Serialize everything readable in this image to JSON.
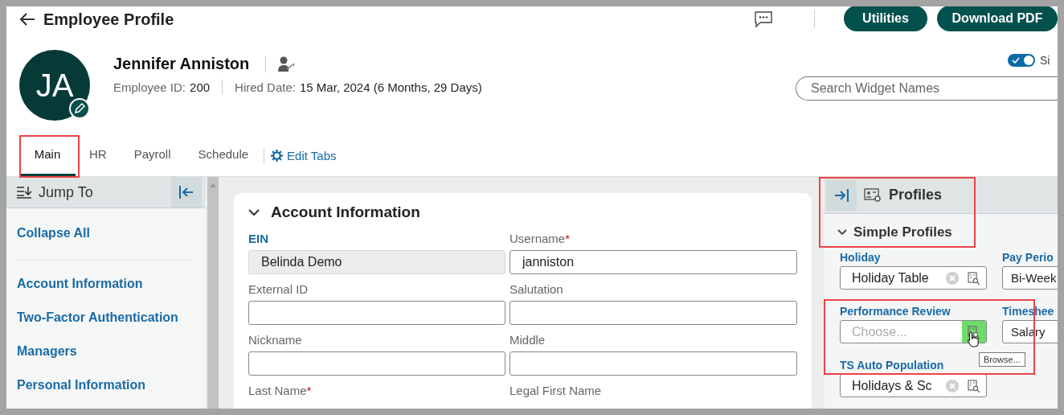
{
  "header": {
    "title": "Employee Profile",
    "buttons": [
      "Utilities",
      "Download PDF"
    ]
  },
  "employee": {
    "initials": "JA",
    "name": "Jennifer Anniston",
    "id_label": "Employee ID:",
    "id": "200",
    "hired_label": "Hired Date:",
    "hired": "15 Mar, 2024 (6 Months, 29 Days)"
  },
  "toggle": {
    "on": true,
    "label": "Si"
  },
  "search": {
    "placeholder": "Search Widget Names"
  },
  "tabs": [
    {
      "label": "Main",
      "selected": true
    },
    {
      "label": "HR",
      "selected": false
    },
    {
      "label": "Payroll",
      "selected": false
    },
    {
      "label": "Schedule",
      "selected": false
    }
  ],
  "edit_tabs": "Edit Tabs",
  "jump_to": {
    "title": "Jump To",
    "collapse_all": "Collapse All",
    "items": [
      "Account Information",
      "Two-Factor Authentication",
      "Managers",
      "Personal Information"
    ]
  },
  "account": {
    "title": "Account Information",
    "fields": [
      {
        "kind": "readonly",
        "label": "EIN",
        "value": "Belinda Demo"
      },
      {
        "kind": "input",
        "label": "Username",
        "required_mark": "*",
        "value": "janniston"
      },
      {
        "kind": "input",
        "label": "External ID"
      },
      {
        "kind": "input",
        "label": "Salutation"
      },
      {
        "kind": "input",
        "label": "Nickname"
      },
      {
        "kind": "input",
        "label": "Middle"
      },
      {
        "kind": "label_only",
        "label": "Last Name",
        "required_mark": "*"
      },
      {
        "kind": "label_only",
        "label": "Legal First Name"
      }
    ]
  },
  "profiles": {
    "title": "Profiles",
    "section": "Simple Profiles",
    "fields": [
      {
        "label": "Holiday",
        "value": "Holiday Table",
        "clearable": true,
        "browse": true
      },
      {
        "label": "Pay Perio",
        "value": "Bi-Week"
      },
      {
        "label": "Performance Review",
        "placeholder": "Choose...",
        "clearable": false,
        "browse": true,
        "tooltip": "Browse..."
      },
      {
        "label": "Timeshee",
        "value": "Salary"
      },
      {
        "label": "TS Auto Population",
        "value": "Holidays & Sc",
        "clearable": true,
        "browse": true
      }
    ]
  }
}
